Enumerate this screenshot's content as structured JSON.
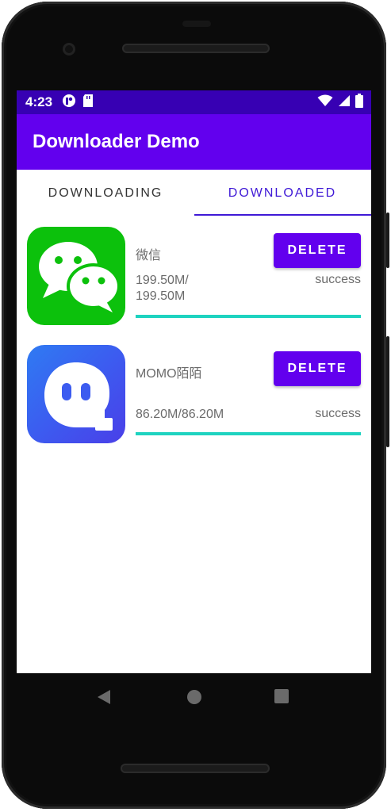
{
  "status_bar": {
    "time": "4:23"
  },
  "app_bar": {
    "title": "Downloader Demo"
  },
  "tabs": [
    {
      "label": "DOWNLOADING"
    },
    {
      "label": "DOWNLOADED"
    }
  ],
  "selected_tab": 1,
  "items": [
    {
      "name": "微信",
      "size_line1": "199.50M/",
      "size_line2": "199.50M",
      "status": "success",
      "delete_label": "DELETE",
      "progress": 1.0,
      "icon": "wechat-icon"
    },
    {
      "name": "MOMO陌陌",
      "size": "86.20M/86.20M",
      "status": "success",
      "delete_label": "DELETE",
      "progress": 1.0,
      "icon": "momo-icon"
    }
  ],
  "colors": {
    "status_bar": "#3700b3",
    "primary": "#6200ee",
    "tab_selected": "#3f19d6",
    "progress": "#1ed3c0"
  }
}
